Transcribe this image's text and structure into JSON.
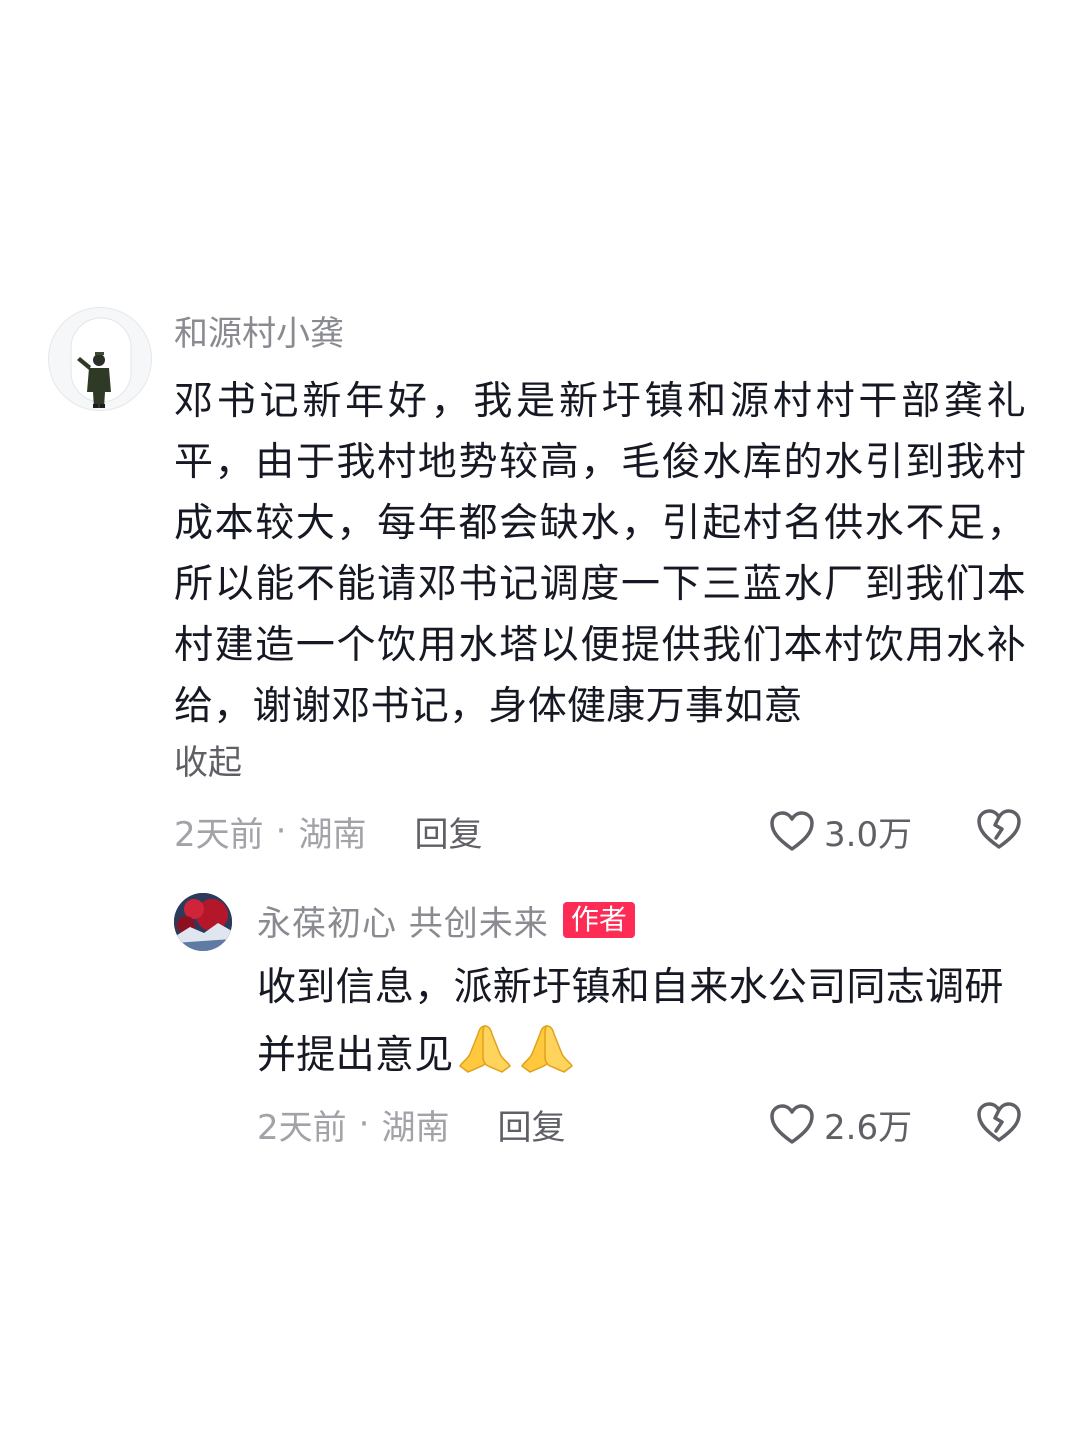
{
  "comment": {
    "author": "和源村小龚",
    "text": "邓书记新年好，我是新圩镇和源村村干部龚礼平，由于我村地势较高，毛俊水库的水引到我村成本较大，每年都会缺水，引起村名供水不足，所以能不能请邓书记调度一下三蓝水厂到我们本村建造一个饮用水塔以便提供我们本村饮用水补给，谢谢邓书记，身体健康万事如意",
    "collapse_label": "收起",
    "time": "2天前",
    "separator": "·",
    "location": "湖南",
    "reply_label": "回复",
    "like_count": "3.0万",
    "like_icon": "heart-outline-icon",
    "dislike_icon": "broken-heart-icon"
  },
  "reply": {
    "author": "永葆初心  共创未来",
    "badge": "作者",
    "badge_color": "#fe2c55",
    "text": "收到信息，派新圩镇和自来水公司同志调研并提出意见",
    "emoji": [
      "praying-hands-emoji",
      "praying-hands-emoji"
    ],
    "time": "2天前",
    "separator": "·",
    "location": "湖南",
    "reply_label": "回复",
    "like_count": "2.6万",
    "like_icon": "heart-outline-icon",
    "dislike_icon": "broken-heart-icon"
  }
}
